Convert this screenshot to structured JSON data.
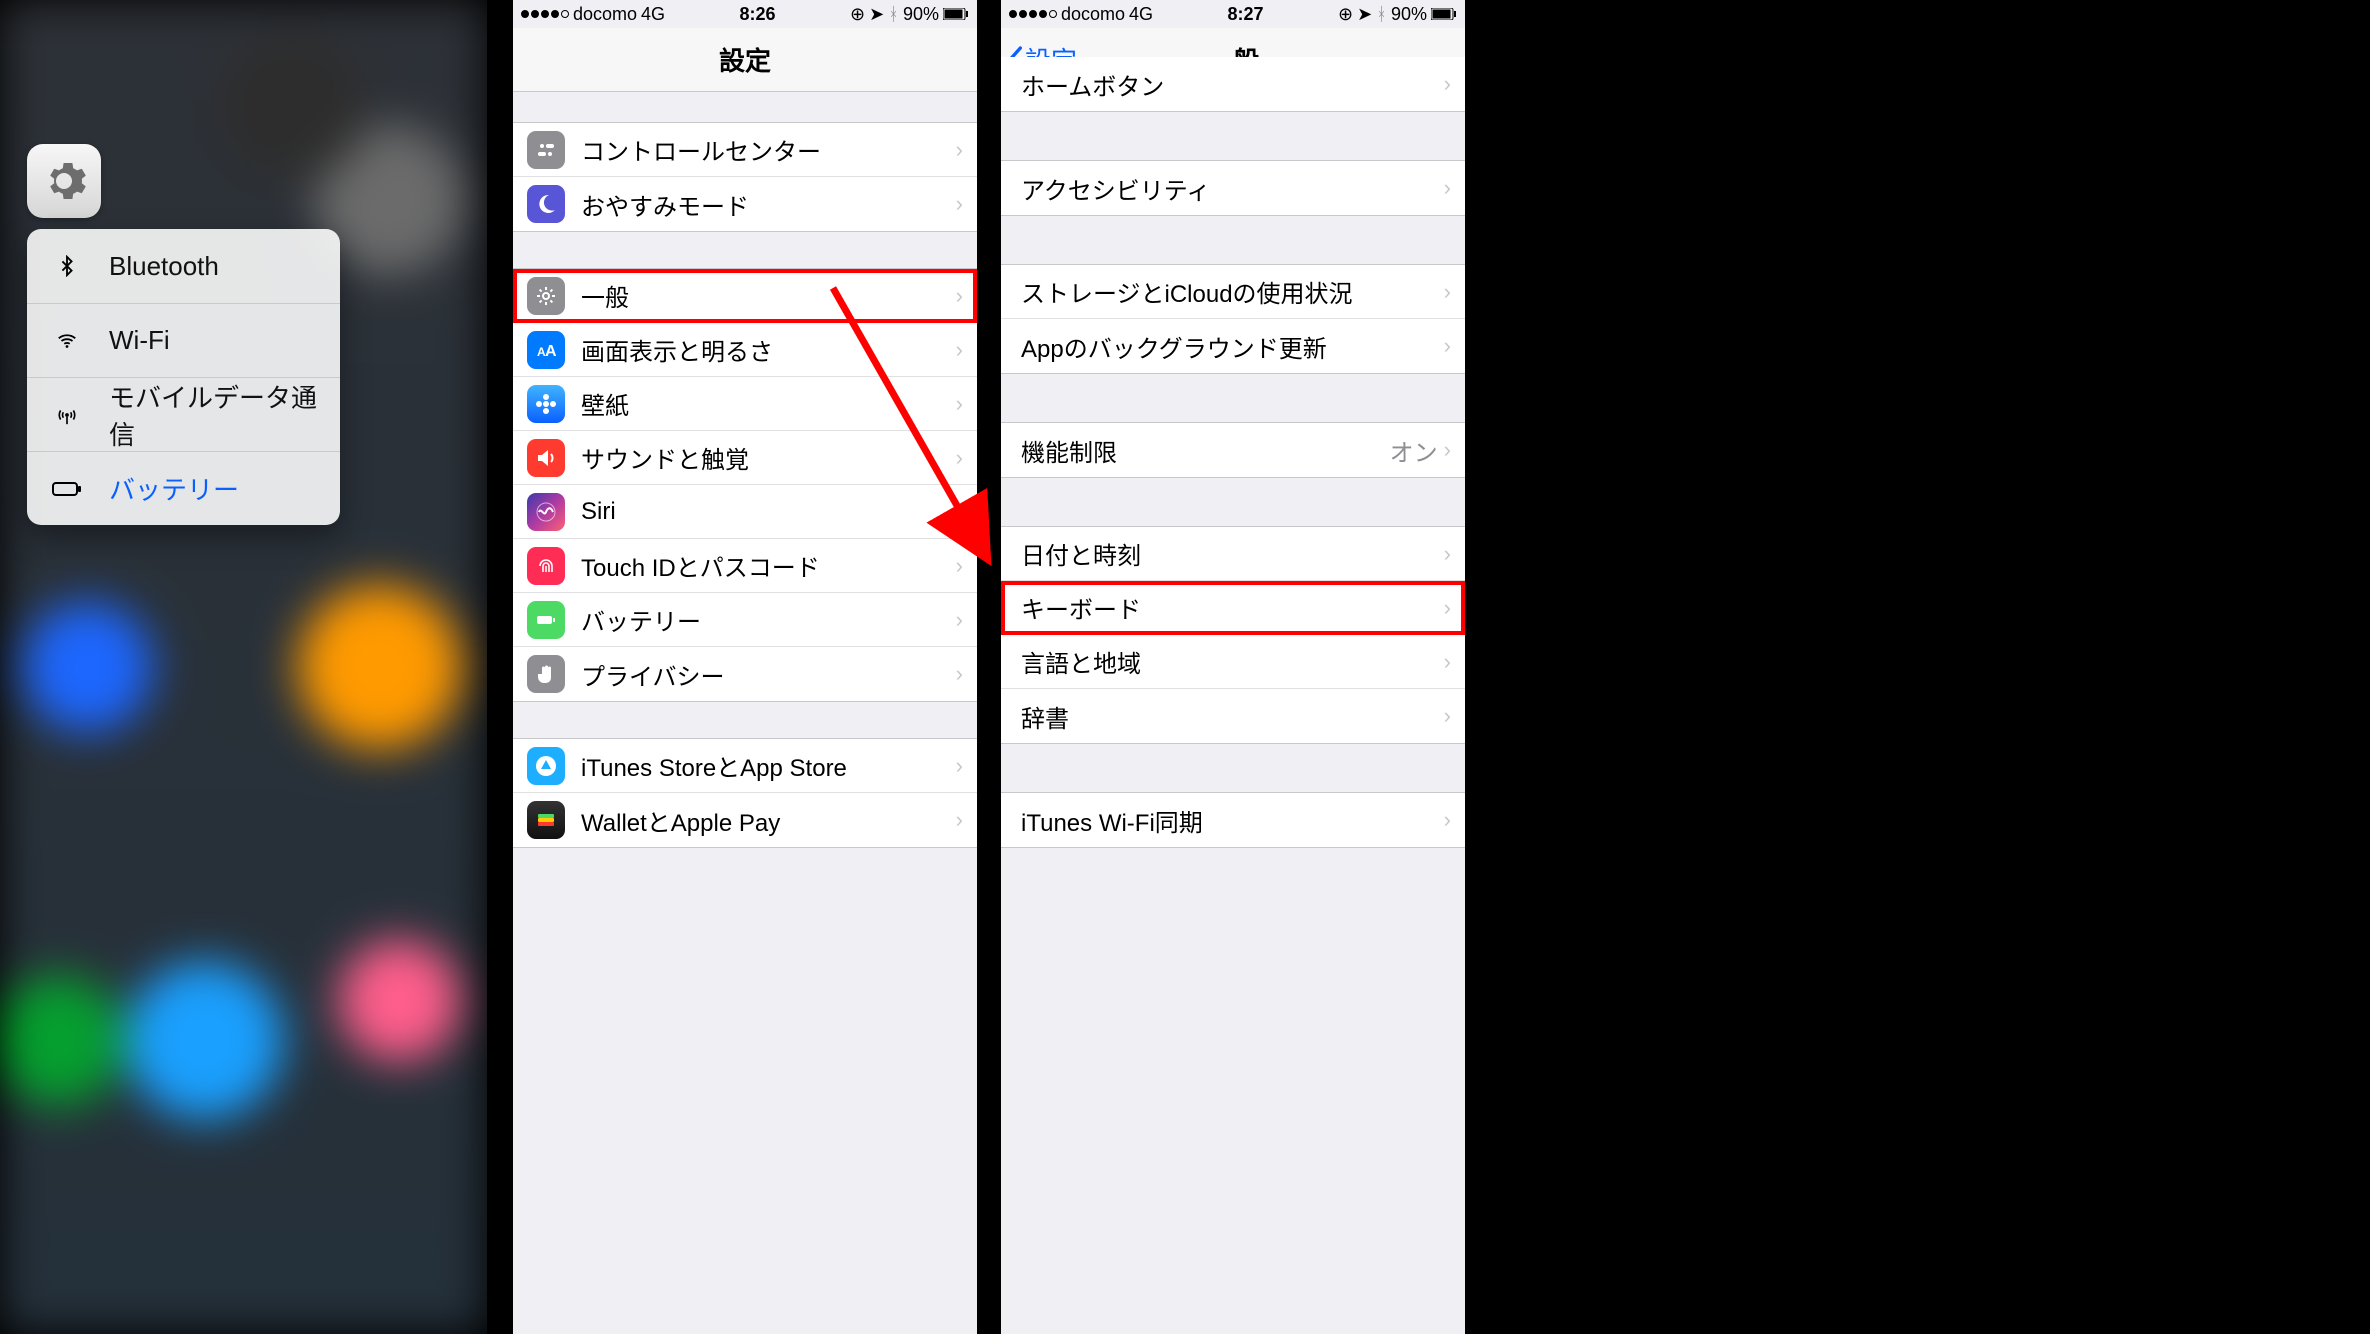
{
  "panel1": {
    "quick_menu": [
      {
        "id": "bluetooth",
        "label": "Bluetooth"
      },
      {
        "id": "wifi",
        "label": "Wi-Fi"
      },
      {
        "id": "cellular",
        "label": "モバイルデータ通信"
      },
      {
        "id": "battery",
        "label": "バッテリー"
      }
    ]
  },
  "panel2": {
    "status": {
      "carrier": "docomo",
      "net": "4G",
      "time": "8:26",
      "battery_pct": "90%"
    },
    "title": "設定",
    "groups": [
      [
        {
          "icon": "control-center",
          "bg": "bg-grey",
          "label": "コントロールセンター"
        },
        {
          "icon": "moon",
          "bg": "bg-purple",
          "label": "おやすみモード"
        }
      ],
      [
        {
          "icon": "gear",
          "bg": "bg-grey",
          "label": "一般",
          "highlight": true
        },
        {
          "icon": "aa",
          "bg": "bg-blue1",
          "label": "画面表示と明るさ"
        },
        {
          "icon": "flower",
          "bg": "bg-wall",
          "label": "壁紙"
        },
        {
          "icon": "speaker",
          "bg": "bg-red",
          "label": "サウンドと触覚"
        },
        {
          "icon": "siri",
          "bg": "bg-siri",
          "label": "Siri"
        },
        {
          "icon": "touchid",
          "bg": "bg-touch",
          "label": "Touch IDとパスコード"
        },
        {
          "icon": "battery",
          "bg": "bg-green",
          "label": "バッテリー"
        },
        {
          "icon": "hand",
          "bg": "bg-grey",
          "label": "プライバシー"
        }
      ],
      [
        {
          "icon": "store",
          "bg": "bg-store",
          "label": "iTunes StoreとApp Store"
        },
        {
          "icon": "wallet",
          "bg": "bg-wallet",
          "label": "WalletとApple Pay"
        }
      ]
    ]
  },
  "panel3": {
    "status": {
      "carrier": "docomo",
      "net": "4G",
      "time": "8:27",
      "battery_pct": "90%"
    },
    "back": "設定",
    "title": "一般",
    "groups": [
      [
        {
          "label": "ホームボタン"
        }
      ],
      [
        {
          "label": "アクセシビリティ"
        }
      ],
      [
        {
          "label": "ストレージとiCloudの使用状況"
        },
        {
          "label": "Appのバックグラウンド更新"
        }
      ],
      [
        {
          "label": "機能制限",
          "value": "オン"
        }
      ],
      [
        {
          "label": "日付と時刻"
        },
        {
          "label": "キーボード",
          "highlight": true
        },
        {
          "label": "言語と地域"
        },
        {
          "label": "辞書"
        }
      ],
      [
        {
          "label": "iTunes Wi-Fi同期"
        }
      ]
    ]
  }
}
